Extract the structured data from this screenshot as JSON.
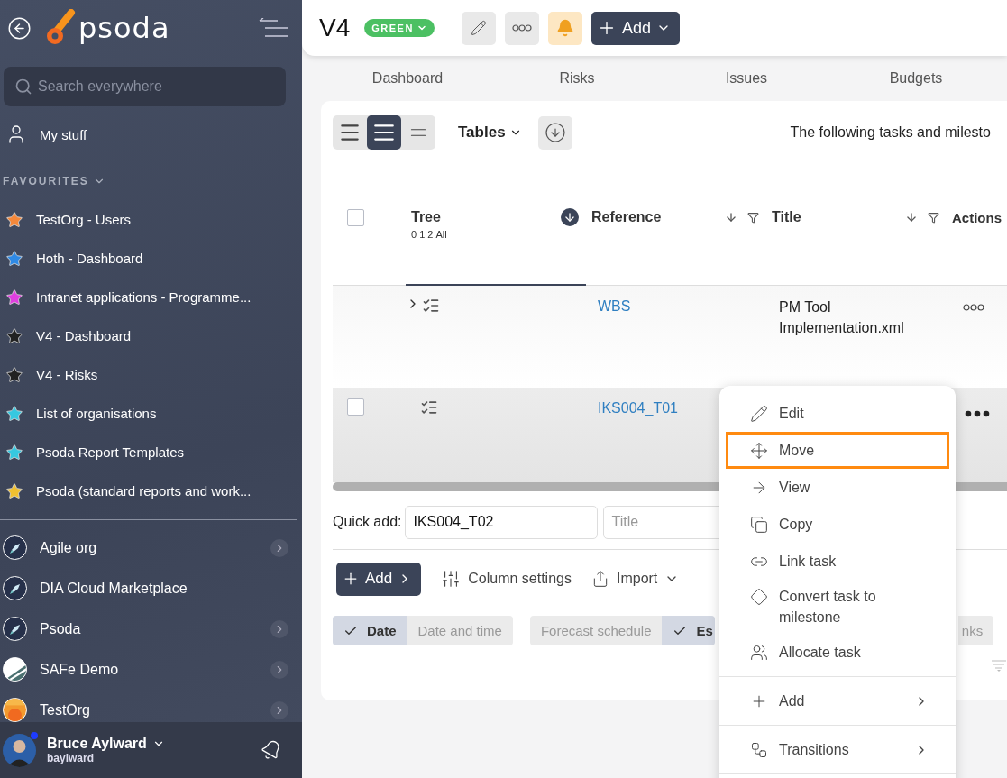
{
  "sidebar": {
    "logo": "psoda",
    "search": {
      "placeholder": "Search everywhere"
    },
    "my_stuff": "My stuff",
    "favourites_heading": "FAVOURITES",
    "favourites": [
      {
        "label": "TestOrg - Users",
        "color": "#f5883a"
      },
      {
        "label": "Hoth - Dashboard",
        "color": "#2f8ae6"
      },
      {
        "label": "Intranet applications - Programme...",
        "color": "#e040e0"
      },
      {
        "label": "V4 - Dashboard",
        "color": "#222222"
      },
      {
        "label": "V4 - Risks",
        "color": "#222222"
      },
      {
        "label": "List of organisations",
        "color": "#36c8e0"
      },
      {
        "label": "Psoda Report Templates",
        "color": "#36c8e0"
      },
      {
        "label": "Psoda (standard reports and work...",
        "color": "#f0c030"
      }
    ],
    "organisations": [
      {
        "label": "Agile org",
        "kind": "rocket",
        "has_children": true
      },
      {
        "label": "DIA Cloud Marketplace",
        "kind": "rocket",
        "has_children": false
      },
      {
        "label": "Psoda",
        "kind": "rocket",
        "has_children": true
      },
      {
        "label": "SAFe Demo",
        "kind": "stripes",
        "has_children": true
      },
      {
        "label": "TestOrg",
        "kind": "sunset",
        "has_children": true
      }
    ],
    "user": {
      "name": "Bruce Aylward",
      "username": "baylward",
      "online": true
    }
  },
  "header": {
    "title": "V4",
    "status": "GREEN",
    "add_button": "Add"
  },
  "tabs": [
    {
      "label": "Dashboard",
      "selected": false
    },
    {
      "label": "Risks",
      "selected": false
    },
    {
      "label": "Issues",
      "selected": false
    },
    {
      "label": "Budgets",
      "selected": false
    }
  ],
  "toolbar": {
    "views": [
      {
        "kind": "compact",
        "selected": false
      },
      {
        "kind": "normal",
        "selected": true
      },
      {
        "kind": "dense",
        "selected": false
      }
    ],
    "tables": "Tables",
    "description": "The following tasks and milesto"
  },
  "table": {
    "select_all": {
      "checked": false
    },
    "columns": [
      {
        "label": "Tree",
        "levels": [
          "0",
          "1",
          "2",
          "All"
        ],
        "sort_active": true
      },
      {
        "label": "Reference",
        "sort_active": false
      },
      {
        "label": "Title",
        "sort_active": false
      },
      {
        "label": "Actions"
      }
    ],
    "rows": [
      {
        "kind": "summary",
        "reference": "WBS",
        "title": "PM Tool Implementation.xml",
        "highlighted": false
      },
      {
        "kind": "task",
        "reference": "IKS004_T01",
        "checked": false,
        "highlighted": true
      }
    ]
  },
  "quick_add": {
    "label": "Quick add:",
    "reference": "IKS004_T02",
    "title_placeholder": "Title"
  },
  "actions": {
    "add": "Add",
    "column_settings": "Column settings",
    "import": "Import"
  },
  "chip_groups": [
    [
      {
        "label": "Date",
        "selected": true
      },
      {
        "label": "Date and time",
        "selected": false
      }
    ],
    [
      {
        "label": "Forecast schedule",
        "selected": false
      },
      {
        "label": "Es",
        "selected": true
      }
    ],
    [
      {
        "label": "nks",
        "selected": false
      }
    ]
  ],
  "context_menu": [
    {
      "kind": "edit",
      "label": "Edit",
      "highlighted": false
    },
    {
      "kind": "move",
      "label": "Move",
      "highlighted": true
    },
    {
      "kind": "view",
      "label": "View",
      "highlighted": false
    },
    {
      "kind": "copy",
      "label": "Copy",
      "highlighted": false
    },
    {
      "kind": "link",
      "label": "Link task",
      "highlighted": false
    },
    {
      "kind": "convert",
      "label": "Convert task to milestone",
      "highlighted": false
    },
    {
      "kind": "allocate",
      "label": "Allocate task",
      "highlighted": false
    },
    {
      "kind": "add",
      "label": "Add",
      "highlighted": false,
      "submenu": true
    },
    {
      "kind": "transitions",
      "label": "Transitions",
      "highlighted": false,
      "submenu": true
    }
  ]
}
